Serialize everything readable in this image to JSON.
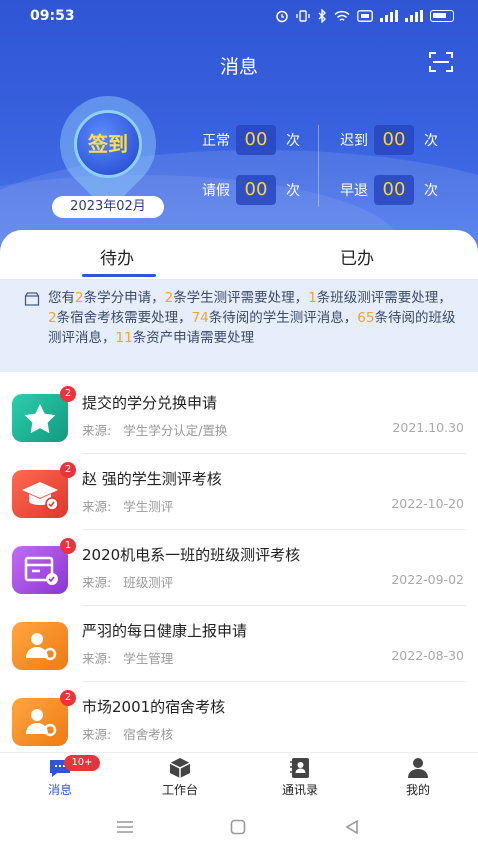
{
  "status": {
    "time": "09:53"
  },
  "header": {
    "title": "消息",
    "checkin_label": "签到",
    "month": "2023年02月"
  },
  "stats": [
    {
      "label": "正常",
      "value": "00",
      "unit": "次"
    },
    {
      "label": "迟到",
      "value": "00",
      "unit": "次"
    },
    {
      "label": "请假",
      "value": "00",
      "unit": "次"
    },
    {
      "label": "早退",
      "value": "00",
      "unit": "次"
    }
  ],
  "tabs": [
    {
      "label": "待办"
    },
    {
      "label": "已办"
    }
  ],
  "notice": {
    "segments": [
      {
        "t": "您有",
        "h": false
      },
      {
        "t": "2",
        "h": true
      },
      {
        "t": "条学分申请，",
        "h": false
      },
      {
        "t": "2",
        "h": true
      },
      {
        "t": "条学生测评需要处理，",
        "h": false
      },
      {
        "t": "1",
        "h": true
      },
      {
        "t": "条班级测评需要处理，",
        "h": false
      },
      {
        "t": "2",
        "h": true
      },
      {
        "t": "条宿舍考核需要处理，",
        "h": false
      },
      {
        "t": "74",
        "h": true
      },
      {
        "t": "条待阅的学生测评消息，",
        "h": false
      },
      {
        "t": "65",
        "h": true
      },
      {
        "t": "条待阅的班级测评消息，",
        "h": false
      },
      {
        "t": "11",
        "h": true
      },
      {
        "t": "条资产申请需要处理",
        "h": false
      }
    ]
  },
  "list": [
    {
      "title": "提交的学分兑换申请",
      "source_label": "来源:",
      "source": "学生学分认定/置换",
      "date": "2021.10.30",
      "badge": "2",
      "icon": "star-icon",
      "color": "#1fb59b"
    },
    {
      "title": "赵 强的学生测评考核",
      "source_label": "来源:",
      "source": "学生测评",
      "date": "2022-10-20",
      "badge": "2",
      "icon": "graduation-cap-icon",
      "color": "#ef4b3f"
    },
    {
      "title": "2020机电系一班的班级测评考核",
      "source_label": "来源:",
      "source": "班级测评",
      "date": "2022-09-02",
      "badge": "1",
      "icon": "class-board-icon",
      "color": "#a84fe0"
    },
    {
      "title": "严羽的每日健康上报申请",
      "source_label": "来源:",
      "source": "学生管理",
      "date": "2022-08-30",
      "badge": "",
      "icon": "person-gear-icon",
      "color": "#f28a1e"
    },
    {
      "title": "市场2001的宿舍考核",
      "source_label": "来源:",
      "source": "宿舍考核",
      "date": "",
      "badge": "2",
      "icon": "person-gear-icon",
      "color": "#f28a1e"
    }
  ],
  "tabbar": [
    {
      "label": "消息",
      "icon": "message-icon",
      "badge": "10+"
    },
    {
      "label": "工作台",
      "icon": "workbench-box-icon",
      "badge": ""
    },
    {
      "label": "通讯录",
      "icon": "contacts-book-icon",
      "badge": ""
    },
    {
      "label": "我的",
      "icon": "user-icon",
      "badge": ""
    }
  ],
  "colors": {
    "primary": "#2e57d6",
    "highlight": "#f5a623",
    "badge": "#e8343a"
  }
}
